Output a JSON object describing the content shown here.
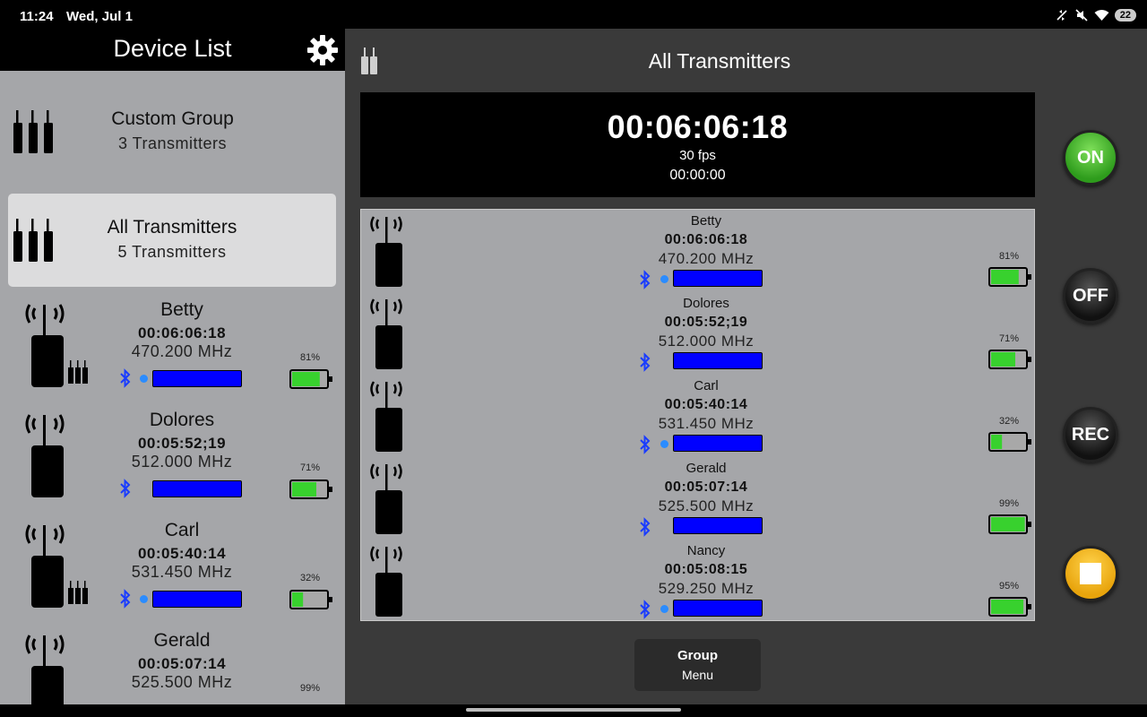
{
  "status_bar": {
    "time": "11:24",
    "date": "Wed, Jul 1",
    "battery": "22",
    "icons": [
      "no-sync-icon",
      "mute-icon",
      "wifi-icon",
      "battery-icon"
    ]
  },
  "left_panel": {
    "title": "Device List",
    "settings_icon": "gear-icon",
    "groups": [
      {
        "name": "Custom Group",
        "count": "3 Transmitters",
        "selected": false
      },
      {
        "name": "All Transmitters",
        "count": "5 Transmitters",
        "selected": true
      }
    ],
    "transmitters": [
      {
        "name": "Betty",
        "timecode": "00:06:06:18",
        "frequency": "470.200 MHz",
        "battery": "81%",
        "battery_level": 0.81,
        "bt_dot": true,
        "in_group": true
      },
      {
        "name": "Dolores",
        "timecode": "00:05:52;19",
        "frequency": "512.000 MHz",
        "battery": "71%",
        "battery_level": 0.71,
        "bt_dot": false,
        "in_group": false
      },
      {
        "name": "Carl",
        "timecode": "00:05:40:14",
        "frequency": "531.450 MHz",
        "battery": "32%",
        "battery_level": 0.32,
        "bt_dot": true,
        "in_group": true
      },
      {
        "name": "Gerald",
        "timecode": "00:05:07:14",
        "frequency": "525.500 MHz",
        "battery": "99%",
        "battery_level": 0.99,
        "bt_dot": false,
        "in_group": false
      }
    ]
  },
  "right_panel": {
    "title": "All Transmitters",
    "timecode": {
      "main": "00:06:06:18",
      "fps": "30 fps",
      "sub": "00:00:00"
    },
    "transmitters": [
      {
        "name": "Betty",
        "timecode": "00:06:06:18",
        "frequency": "470.200 MHz",
        "battery": "81%",
        "battery_level": 0.81,
        "bt_dot": true
      },
      {
        "name": "Dolores",
        "timecode": "00:05:52;19",
        "frequency": "512.000 MHz",
        "battery": "71%",
        "battery_level": 0.71,
        "bt_dot": false
      },
      {
        "name": "Carl",
        "timecode": "00:05:40:14",
        "frequency": "531.450 MHz",
        "battery": "32%",
        "battery_level": 0.32,
        "bt_dot": true
      },
      {
        "name": "Gerald",
        "timecode": "00:05:07:14",
        "frequency": "525.500 MHz",
        "battery": "99%",
        "battery_level": 0.99,
        "bt_dot": false
      },
      {
        "name": "Nancy",
        "timecode": "00:05:08:15",
        "frequency": "529.250 MHz",
        "battery": "95%",
        "battery_level": 0.95,
        "bt_dot": true
      }
    ],
    "group_menu": {
      "line1": "Group",
      "line2": "Menu"
    },
    "buttons": {
      "on": "ON",
      "off": "OFF",
      "rec": "REC",
      "stop_icon": "stop-icon"
    }
  },
  "colors": {
    "panel_gray": "#a5a6a9",
    "selected_group": "#dcdcdd",
    "rf_bar": "#0000ff",
    "battery_green": "#38d12e",
    "bluetooth": "#1a3cff",
    "on_green": "#3fb324",
    "stop_yellow": "#f2b31a"
  }
}
